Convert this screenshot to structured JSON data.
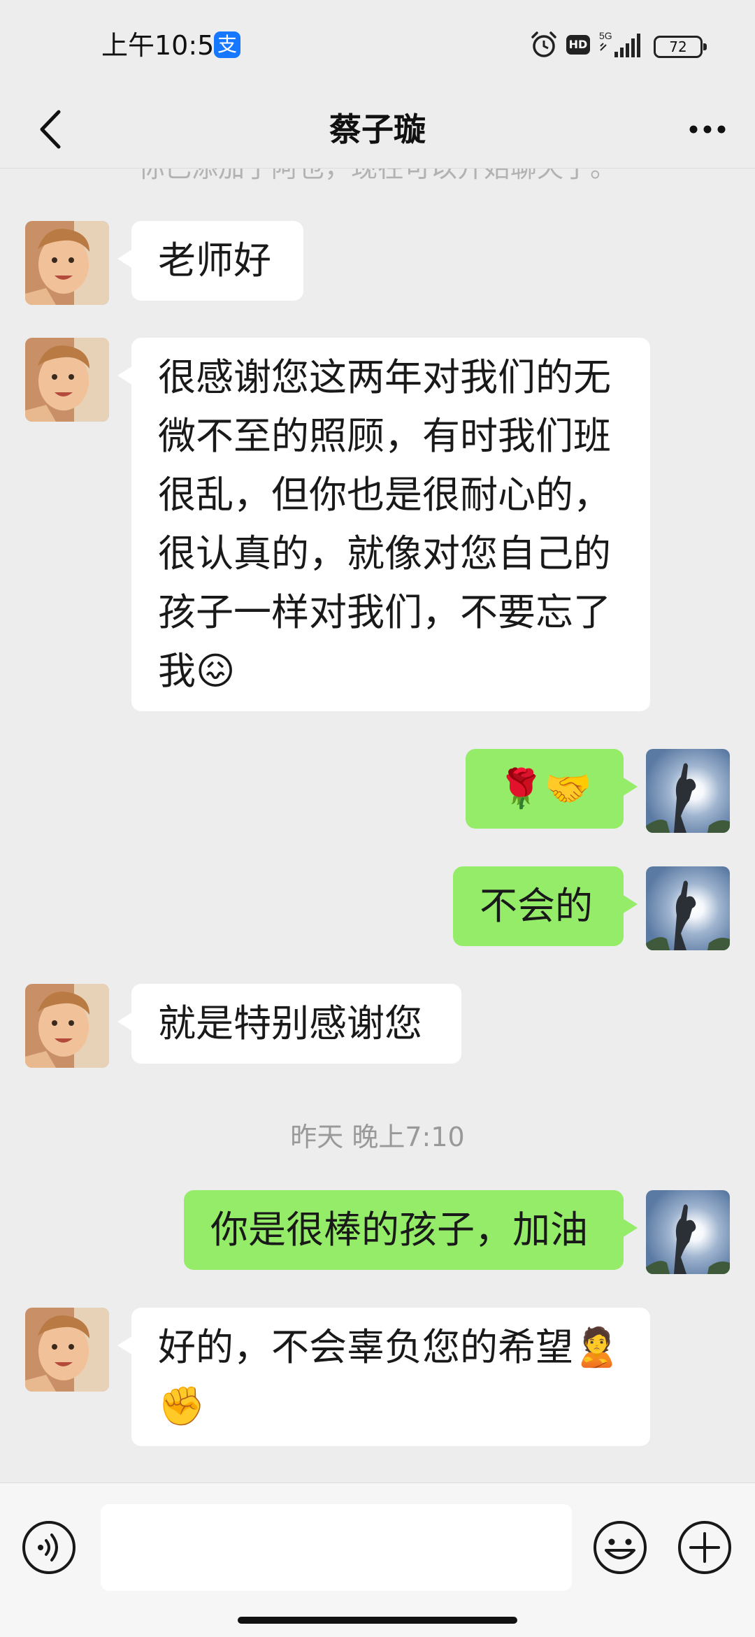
{
  "status_bar": {
    "time": "上午10:53",
    "alipay_glyph": "支",
    "hd_label": "HD",
    "network_label": "5G",
    "battery": "72"
  },
  "nav": {
    "title": "蔡子璇",
    "back_icon": "chevron-left-icon",
    "more_icon": "more-dots-icon"
  },
  "chat": {
    "system_notice": "你已添加了阿也，现在可以开始聊天了。",
    "messages": [
      {
        "side": "left",
        "text": "老师好"
      },
      {
        "side": "left",
        "text": "很感谢您这两年对我们的无微不至的照顾，有时我们班很乱，但你也是很耐心的，很认真的，就像对您自己的孩子一样对我们，不要忘了我😖"
      },
      {
        "side": "right",
        "text": "🌹🤝"
      },
      {
        "side": "right",
        "text": "不会的"
      },
      {
        "side": "left",
        "text": "就是特别感谢您"
      },
      {
        "side": "right",
        "text": "你是很棒的孩子，加油"
      },
      {
        "side": "left",
        "text": "好的，不会辜负您的希望🙎✊"
      }
    ],
    "timestamp": "昨天 晚上7:10"
  },
  "input_bar": {
    "voice_icon": "voice-icon",
    "input_value": "",
    "emoji_icon": "emoji-icon",
    "plus_icon": "plus-icon"
  },
  "colors": {
    "background": "#ededed",
    "incoming_bubble": "#ffffff",
    "outgoing_bubble": "#95ec69",
    "alipay_blue": "#1677ff"
  }
}
